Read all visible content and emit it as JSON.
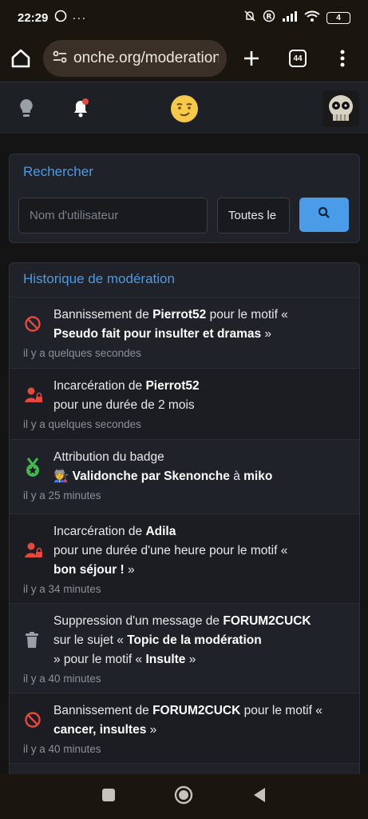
{
  "status": {
    "time": "22:29",
    "battery": "4"
  },
  "browser": {
    "url": "onche.org/moderation",
    "tab_count": "44"
  },
  "search": {
    "title": "Rechercher",
    "username_placeholder": "Nom d'utilisateur",
    "filter_value": "Toutes le"
  },
  "history": {
    "title": "Historique de modération",
    "entries": [
      {
        "icon": "ban-icon",
        "p1": "Bannissement de ",
        "b1": "Pierrot52",
        "p2": " pour le motif « ",
        "b2": "Pseudo fait pour insulter et dramas",
        "p3": " »",
        "time": "il y a quelques secondes"
      },
      {
        "icon": "jail-icon",
        "p1": "Incarcération de ",
        "b1": "Pierrot52",
        "p2": "pour une durée de 2 mois",
        "time": "il y a quelques secondes"
      },
      {
        "icon": "badge-icon",
        "p1": "Attribution du badge",
        "emoji": "🧑‍🏭",
        "b1": "Validonche par Skenonche",
        "p2": " à ",
        "b2": "miko",
        "time": "il y a 25 minutes"
      },
      {
        "icon": "jail-icon",
        "p1": "Incarcération de ",
        "b1": "Adila",
        "p2": "pour une durée d'une heure pour le motif « ",
        "b2": "bon séjour !",
        "p3": " »",
        "time": "il y a 34 minutes"
      },
      {
        "icon": "trash-icon",
        "p1": "Suppression d'un message de ",
        "b1": "FORUM2CUCK",
        "p2": "sur le sujet « ",
        "b2": "Topic de la modération",
        "p3": " » pour le motif « ",
        "b3": "Insulte",
        "p4": " »",
        "time": "il y a 40 minutes"
      },
      {
        "icon": "ban-icon",
        "p1": "Bannissement de ",
        "b1": "FORUM2CUCK",
        "p2": " pour le motif « ",
        "b2": "cancer, insultes",
        "p3": " »",
        "time": "il y a 40 minutes"
      }
    ]
  },
  "colors": {
    "accent": "#4a9be8",
    "danger": "#e5483c",
    "success": "#3fb950"
  }
}
